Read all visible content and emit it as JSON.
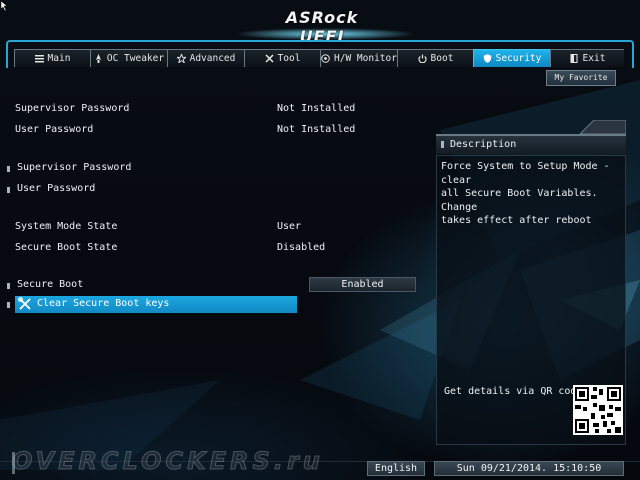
{
  "header": {
    "logo": "ASRock UEFI"
  },
  "tabs": [
    {
      "label": "Main",
      "icon": "list-icon",
      "active": false
    },
    {
      "label": "OC Tweaker",
      "icon": "rocket-icon",
      "active": false
    },
    {
      "label": "Advanced",
      "icon": "star-icon",
      "active": false
    },
    {
      "label": "Tool",
      "icon": "tools-icon",
      "active": false
    },
    {
      "label": "H/W Monitor",
      "icon": "monitor-icon",
      "active": false
    },
    {
      "label": "Boot",
      "icon": "power-icon",
      "active": false
    },
    {
      "label": "Security",
      "icon": "shield-icon",
      "active": true
    },
    {
      "label": "Exit",
      "icon": "exit-icon",
      "active": false
    }
  ],
  "my_favorite": "My Favorite",
  "info_rows": [
    {
      "label": "Supervisor Password",
      "value": "Not Installed"
    },
    {
      "label": "User Password",
      "value": "Not Installed"
    }
  ],
  "menu_rows": [
    {
      "label": "Supervisor Password"
    },
    {
      "label": "User Password"
    }
  ],
  "state_rows": [
    {
      "label": "System Mode State",
      "value": "User"
    },
    {
      "label": "Secure Boot State",
      "value": "Disabled"
    }
  ],
  "secure_boot": {
    "label": "Secure Boot",
    "value": "Enabled"
  },
  "selected_item": {
    "label": "Clear Secure Boot keys",
    "icon": "wrench-icon"
  },
  "description": {
    "title": "Description",
    "text": "Force System to Setup Mode - clear\nall Secure Boot Variables. Change\ntakes effect after reboot",
    "qr_label": "Get details via QR code"
  },
  "footer": {
    "watermark": "OVERCLOCKERS.ru",
    "language": "English",
    "datetime": "Sun 09/21/2014. 15:10:50"
  },
  "colors": {
    "accent": "#1ba7e0",
    "frame": "#2aa6d6"
  }
}
